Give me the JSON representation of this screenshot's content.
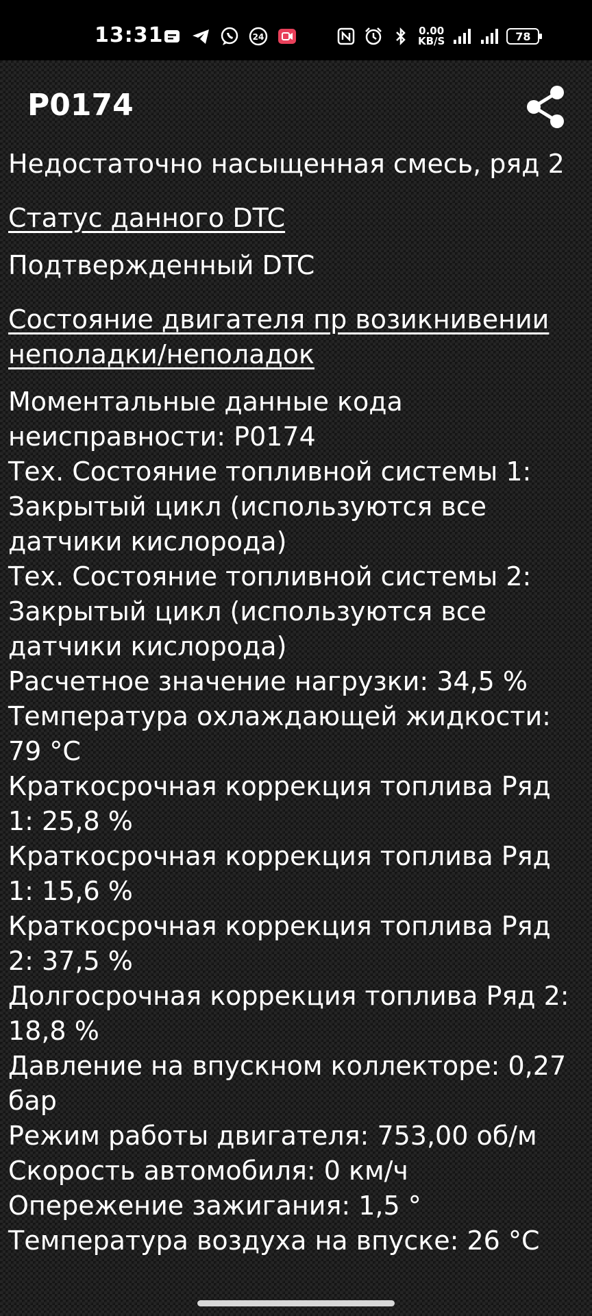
{
  "status_bar": {
    "time": "13:31",
    "notification_icons": [
      "message-icon",
      "telegram-icon",
      "viber-icon",
      "24-icon",
      "screen-record-icon"
    ],
    "notification_24_label": "24",
    "net_speed_value": "0.00",
    "net_speed_unit": "KB/S",
    "system_icons": [
      "nfc-icon",
      "alarm-icon",
      "bluetooth-icon",
      "signal-icon",
      "signal-icon-2"
    ],
    "battery_level": "78"
  },
  "header": {
    "title": "P0174",
    "share_icon": "share-icon"
  },
  "dtc": {
    "description": "Недостаточно насыщенная смесь, ряд 2",
    "status_heading": "Статус данного DTC",
    "status_value": "Подтвержденный DTC",
    "freeze_heading": "Состояние двигателя пр возикнивении неполадки/неполадок",
    "freeze_frame": [
      "Моментальные данные кода неисправности: P0174",
      "Тех. Состояние топливной системы 1: Закрытый цикл (используются все датчики кислорода)",
      "Тех. Состояние топливной системы 2: Закрытый цикл (используются все датчики кислорода)",
      "Расчетное значение нагрузки: 34,5 %",
      "Температура охлаждающей жидкости: 79 °C",
      "Краткосрочная коррекция топлива Ряд 1: 25,8 %",
      "Краткосрочная коррекция топлива Ряд 1: 15,6 %",
      "Краткосрочная коррекция топлива Ряд 2: 37,5 %",
      "Долгосрочная коррекция топлива Ряд 2: 18,8 %",
      "Давление на впускном коллекторе: 0,27 бар",
      "Режим работы двигателя: 753,00 об/м",
      "Скорость автомобиля: 0 км/ч",
      "Опережение зажигания: 1,5 °",
      "Температура воздуха на впуске: 26 °C"
    ]
  }
}
